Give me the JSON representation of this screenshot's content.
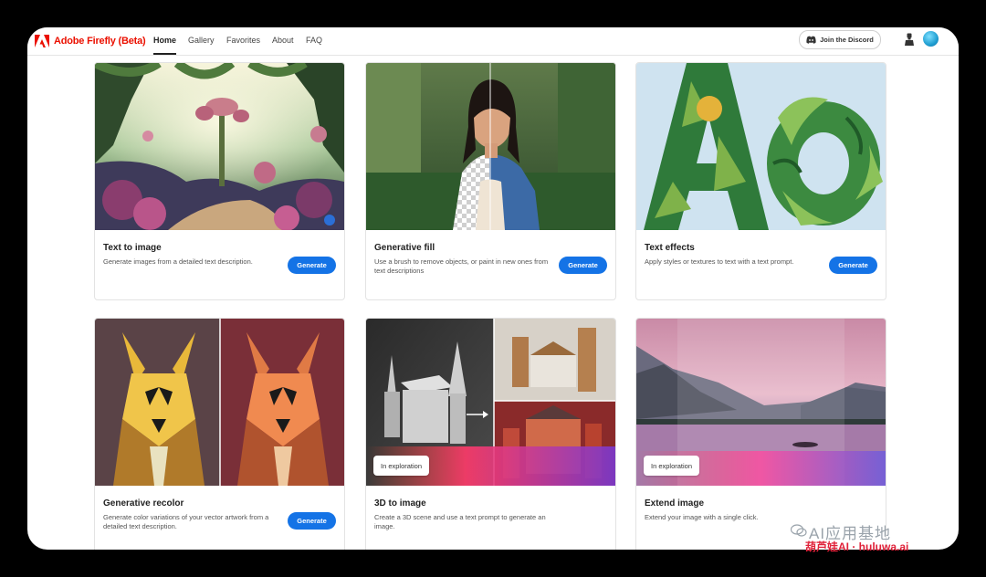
{
  "brand": {
    "name": "Adobe Firefly (Beta)"
  },
  "nav": {
    "links": [
      "Home",
      "Gallery",
      "Favorites",
      "About",
      "FAQ"
    ],
    "active": "Home",
    "discord_label": "Join the Discord"
  },
  "cards": [
    {
      "title": "Text to image",
      "description": "Generate images from a detailed text description.",
      "button": "Generate"
    },
    {
      "title": "Generative fill",
      "description": "Use a brush to remove objects, or paint in new ones from text descriptions",
      "button": "Generate"
    },
    {
      "title": "Text effects",
      "description": "Apply styles or textures to text with a text prompt.",
      "button": "Generate"
    },
    {
      "title": "Generative recolor",
      "description": "Generate color variations of your vector artwork from a detailed text description.",
      "button": "Generate"
    },
    {
      "title": "3D to image",
      "description": "Create a 3D scene and use a text prompt to generate an image.",
      "badge": "In exploration"
    },
    {
      "title": "Extend image",
      "description": "Extend your image with a single click.",
      "badge": "In exploration"
    }
  ],
  "effect_letters": "AO",
  "watermark": {
    "line1": "AI应用基地",
    "line2": "葫芦娃AI · huluwa.ai"
  },
  "colors": {
    "accent": "#1473e6",
    "brand": "#eb1000",
    "frame": "#000000"
  },
  "icons": [
    "adobe-logo-icon",
    "discord-icon",
    "user-icon",
    "avatar-icon"
  ]
}
